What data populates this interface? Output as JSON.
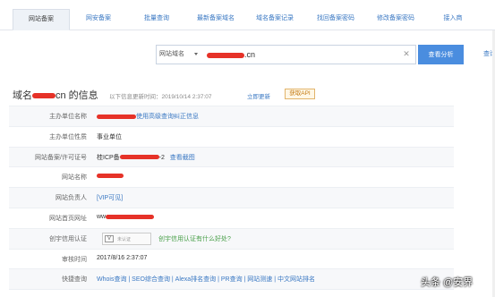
{
  "tabs": [
    {
      "label": "网站备案",
      "active": true
    },
    {
      "label": "网安备案"
    },
    {
      "label": "批量查询"
    },
    {
      "label": "最新备案域名"
    },
    {
      "label": "域名备案记录"
    },
    {
      "label": "找回备案密码"
    },
    {
      "label": "修改备案密码"
    },
    {
      "label": "接入商"
    }
  ],
  "search": {
    "type_label": "网站域名",
    "domain_suffix": ".cn",
    "clear_icon": "close-icon",
    "query_button": "查看分析",
    "query_link": "查询记"
  },
  "title": {
    "prefix": "域名",
    "suffix": "cn 的信息",
    "update_label": "以下信息更新时间：2019/10/14 2:37:07",
    "refresh": "立即更新",
    "api": "获取API"
  },
  "rows": [
    {
      "label": "主办单位名称",
      "value": "使用高级查询纠正信息"
    },
    {
      "label": "主办单位性质",
      "value": "事业单位"
    },
    {
      "label": "网站备案/许可证号",
      "value": "桂ICP备",
      "value_suffix": "-2",
      "link": "查看截图"
    },
    {
      "label": "网站名称",
      "value": ""
    },
    {
      "label": "网站负责人",
      "value": "[VIP可见]"
    },
    {
      "label": "网站首页网址",
      "value": "ww"
    },
    {
      "label": "创宇信用认证",
      "badge": "未认证",
      "value": "创宇信用认证有什么好处?"
    },
    {
      "label": "审核时间",
      "value": "2017/8/16 2:37:07"
    },
    {
      "label": "快捷查询",
      "value": "Whois查询 | SEO综合查询 | Alexa排名查询 | PR查询 | 网站测速 | 中文网站排名"
    }
  ],
  "watermark": "头条 @安界"
}
